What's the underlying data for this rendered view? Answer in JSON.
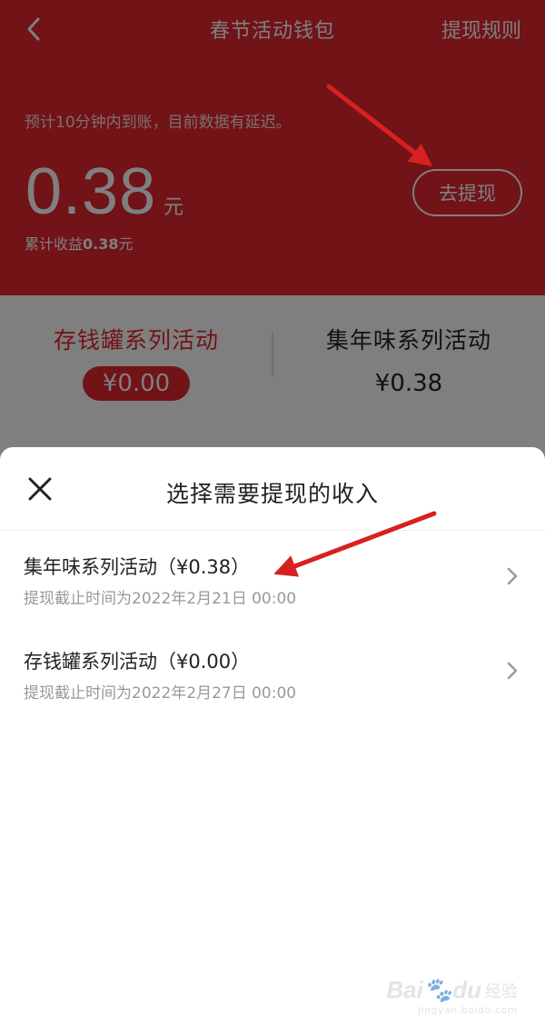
{
  "header": {
    "title": "春节活动钱包",
    "rules_link": "提现规则",
    "notice": "预计10分钟内到账，目前数据有延迟。",
    "balance_amount": "0.38",
    "balance_unit": "元",
    "cumulative_label": "累计收益",
    "cumulative_value": "0.38",
    "cumulative_unit": "元",
    "withdraw_button": "去提现"
  },
  "tabs": [
    {
      "title": "存钱罐系列活动",
      "amount": "¥0.00",
      "selected": true
    },
    {
      "title": "集年味系列活动",
      "amount": "¥0.38",
      "selected": false
    }
  ],
  "sheet": {
    "title": "选择需要提现的收入",
    "items": [
      {
        "title": "集年味系列活动（¥0.38）",
        "subtitle": "提现截止时间为2022年2月21日 00:00"
      },
      {
        "title": "存钱罐系列活动（¥0.00）",
        "subtitle": "提现截止时间为2022年2月27日 00:00"
      }
    ]
  },
  "colors": {
    "accent_red": "#e3262f",
    "annotation_red": "#d8211e"
  },
  "icons": {
    "back": "chevron-left-icon",
    "close": "close-icon",
    "item_arrow": "chevron-right-icon"
  },
  "watermark": {
    "brand": "Bai",
    "brand_suffix": "du",
    "text": "经验",
    "domain": "jingyan.baidu.com"
  }
}
